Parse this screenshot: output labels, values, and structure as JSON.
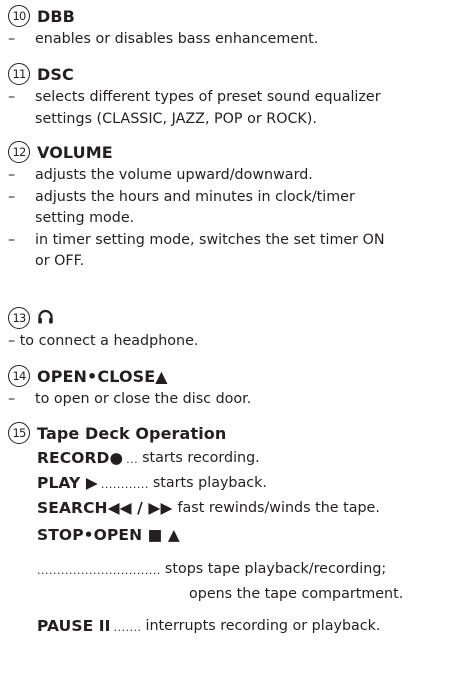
{
  "sections": [
    {
      "number": "10",
      "title": "DBB",
      "lines": [
        {
          "dash": "–",
          "text": "enables or disables bass enhancement."
        }
      ]
    },
    {
      "number": "11",
      "title": "DSC",
      "lines": [
        {
          "dash": "–",
          "text": "selects different types of preset sound equalizer"
        },
        {
          "dash": "",
          "text": "settings (CLASSIC, JAZZ, POP or ROCK)."
        }
      ]
    },
    {
      "number": "12",
      "title": "VOLUME",
      "lines": [
        {
          "dash": "–",
          "text": "adjusts the volume upward/downward."
        },
        {
          "dash": "–",
          "text": "adjusts the hours and minutes in clock/timer"
        },
        {
          "dash": "",
          "text": "setting mode."
        },
        {
          "dash": "–",
          "text": "in timer setting mode, switches the set timer ON"
        },
        {
          "dash": "",
          "text": "or OFF."
        }
      ]
    },
    {
      "number": "13",
      "title_icon": "headphone-icon",
      "lines": [
        {
          "dash": "–",
          "text": "to connect a headphone."
        }
      ]
    },
    {
      "number": "14",
      "title": "OPEN•CLOSE▲",
      "lines": [
        {
          "dash": "–",
          "text": "to open or close the disc door."
        }
      ]
    },
    {
      "number": "15",
      "title": "Tape Deck Operation"
    }
  ],
  "tape": {
    "record": {
      "key": "RECORD●",
      "dots": "...",
      "desc": "starts recording."
    },
    "play": {
      "key": "PLAY ▶",
      "dots": "............",
      "desc": "starts playback."
    },
    "search": {
      "key": "SEARCH◀◀ / ▶▶",
      "desc": "fast rewinds/winds the tape."
    },
    "stop": {
      "key": "STOP•OPEN ■ ▲",
      "dots": "...............................",
      "desc1": "stops tape playback/recording;",
      "desc2": "opens the tape compartment."
    },
    "pause": {
      "key": "PAUSE II",
      "dots": ".......",
      "desc": "interrupts recording or playback."
    }
  },
  "colors": {
    "text": "#231f20",
    "background": "#ffffff"
  }
}
